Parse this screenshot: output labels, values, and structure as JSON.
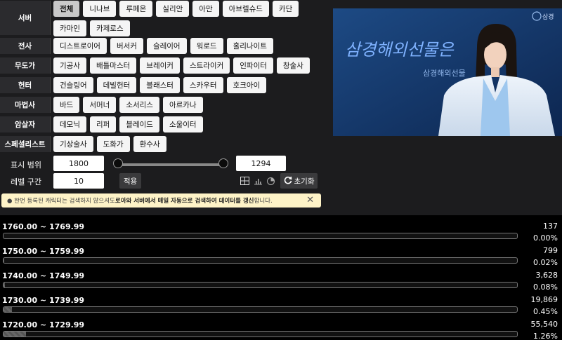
{
  "filters": {
    "server": {
      "label": "서버",
      "items": [
        "전체",
        "니나브",
        "루페온",
        "실리안",
        "아만",
        "아브렐슈드",
        "카단",
        "카마인",
        "카제로스"
      ]
    },
    "warrior": {
      "label": "전사",
      "items": [
        "디스트로이어",
        "버서커",
        "슬레이어",
        "워로드",
        "홀리나이트"
      ]
    },
    "martial": {
      "label": "무도가",
      "items": [
        "기공사",
        "배틀마스터",
        "브레이커",
        "스트라이커",
        "인파이터",
        "창술사"
      ]
    },
    "hunter": {
      "label": "헌터",
      "items": [
        "건슬링어",
        "데빌헌터",
        "블래스터",
        "스카우터",
        "호크아이"
      ]
    },
    "mage": {
      "label": "마법사",
      "items": [
        "바드",
        "서머너",
        "소서리스",
        "아르카나"
      ]
    },
    "assassin": {
      "label": "암살자",
      "items": [
        "데모닉",
        "리퍼",
        "블레이드",
        "소울이터"
      ]
    },
    "specialist": {
      "label": "스페셜리스트",
      "items": [
        "기상술사",
        "도화가",
        "환수사"
      ]
    }
  },
  "range": {
    "label": "표시 범위",
    "min": "1800",
    "max": "1294"
  },
  "level": {
    "label": "레벨 구간",
    "value": "10",
    "apply": "적용",
    "reset": "초기화"
  },
  "notice": {
    "pre": "● 한번 등록된 캐릭터는 검색하지 않으셔도 ",
    "bold": "로아와 서버에서 매일 자동으로 검색하여 데이터를 갱신",
    "post": " 합니다."
  },
  "video": {
    "handwriting": "삼경해외선물은",
    "subtitle": "삼경해외선물",
    "brand": "삼경"
  },
  "rows": [
    {
      "range": "1760.00 ~ 1769.99",
      "count": "137",
      "pct": "0.00%",
      "fill": 0.0
    },
    {
      "range": "1750.00 ~ 1759.99",
      "count": "799",
      "pct": "0.02%",
      "fill": 0.0002
    },
    {
      "range": "1740.00 ~ 1749.99",
      "count": "3,628",
      "pct": "0.08%",
      "fill": 0.0008
    },
    {
      "range": "1730.00 ~ 1739.99",
      "count": "19,869",
      "pct": "0.45%",
      "fill": 0.0045
    },
    {
      "range": "1720.00 ~ 1729.99",
      "count": "55,540",
      "pct": "1.26%",
      "fill": 0.0126
    }
  ]
}
